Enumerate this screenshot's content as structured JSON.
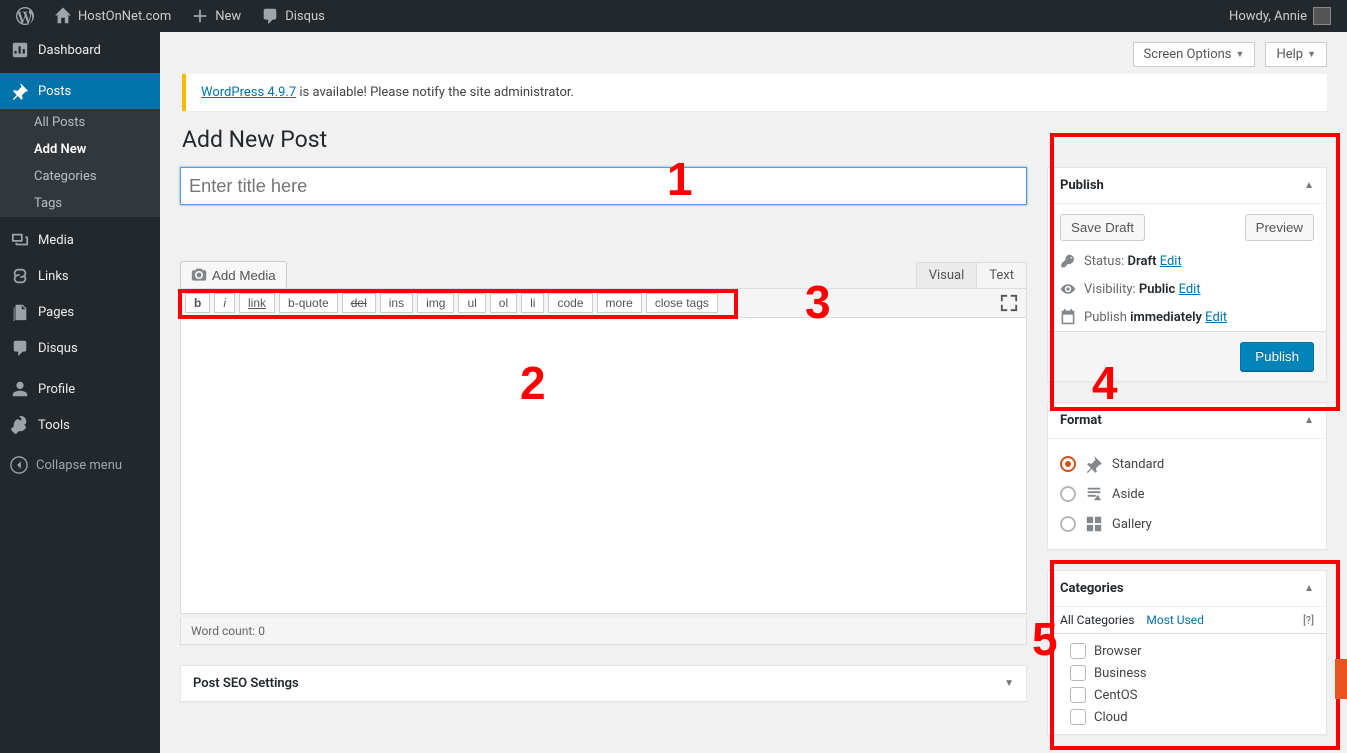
{
  "adminbar": {
    "site_name": "HostOnNet.com",
    "new_label": "New",
    "disqus_label": "Disqus",
    "howdy_prefix": "Howdy, ",
    "user_name": "Annie"
  },
  "sidebar": {
    "dashboard": "Dashboard",
    "posts": "Posts",
    "posts_sub": {
      "all": "All Posts",
      "add_new": "Add New",
      "categories": "Categories",
      "tags": "Tags"
    },
    "media": "Media",
    "links": "Links",
    "pages": "Pages",
    "disqus": "Disqus",
    "profile": "Profile",
    "tools": "Tools",
    "collapse": "Collapse menu"
  },
  "top_options": {
    "screen_options": "Screen Options",
    "help": "Help"
  },
  "notice": {
    "link_text": "WordPress 4.9.7",
    "message": " is available! Please notify the site administrator."
  },
  "page_title": "Add New Post",
  "title_placeholder": "Enter title here",
  "title_value": "",
  "add_media_label": "Add Media",
  "editor": {
    "tab_visual": "Visual",
    "tab_text": "Text",
    "qt": {
      "b": "b",
      "i": "i",
      "link": "link",
      "bquote": "b-quote",
      "del": "del",
      "ins": "ins",
      "img": "img",
      "ul": "ul",
      "ol": "ol",
      "li": "li",
      "code": "code",
      "more": "more",
      "close": "close tags"
    },
    "word_count_label": "Word count: ",
    "word_count_value": "0"
  },
  "seo_box_title": "Post SEO Settings",
  "publish": {
    "title": "Publish",
    "save_draft_label": "Save Draft",
    "preview_label": "Preview",
    "status_label": "Status: ",
    "status_value": "Draft",
    "visibility_label": "Visibility: ",
    "visibility_value": "Public",
    "publish_label": "Publish ",
    "publish_value": "immediately",
    "edit_label": "Edit",
    "publish_button": "Publish"
  },
  "format": {
    "title": "Format",
    "options": {
      "standard": "Standard",
      "aside": "Aside",
      "gallery": "Gallery"
    }
  },
  "categories": {
    "title": "Categories",
    "tab_all": "All Categories",
    "tab_most": "Most Used",
    "help_link": "[?]",
    "items": [
      "Browser",
      "Business",
      "CentOS",
      "Cloud"
    ]
  },
  "annotations": {
    "1": "1",
    "2": "2",
    "3": "3",
    "4": "4",
    "5": "5"
  }
}
